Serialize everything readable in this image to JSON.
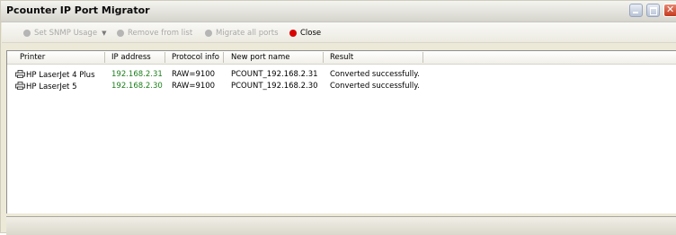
{
  "window": {
    "title": "Pcounter IP Port Migrator"
  },
  "toolbar": {
    "set_snmp": "Set SNMP Usage",
    "remove": "Remove from list",
    "migrate": "Migrate all ports",
    "close": "Close"
  },
  "table": {
    "headers": [
      "Printer",
      "IP address",
      "Protocol info",
      "New port name",
      "Result"
    ],
    "rows": [
      {
        "printer": "HP LaserJet 4 Plus",
        "ip": "192.168.2.31",
        "protocol": "RAW=9100",
        "port_name": "PCOUNT_192.168.2.31",
        "result": "Converted successfully."
      },
      {
        "printer": "HP LaserJet 5",
        "ip": "192.168.2.30",
        "protocol": "RAW=9100",
        "port_name": "PCOUNT_192.168.2.30",
        "result": "Converted successfully."
      }
    ]
  },
  "colors": {
    "ip_text": "#1b7f1b",
    "close_dot": "#d90000",
    "disabled_text": "#a8a8a8"
  },
  "icons": {
    "row": "printer-icon",
    "window_min": "minimize-icon",
    "window_max": "maximize-icon",
    "window_close": "close-icon"
  }
}
